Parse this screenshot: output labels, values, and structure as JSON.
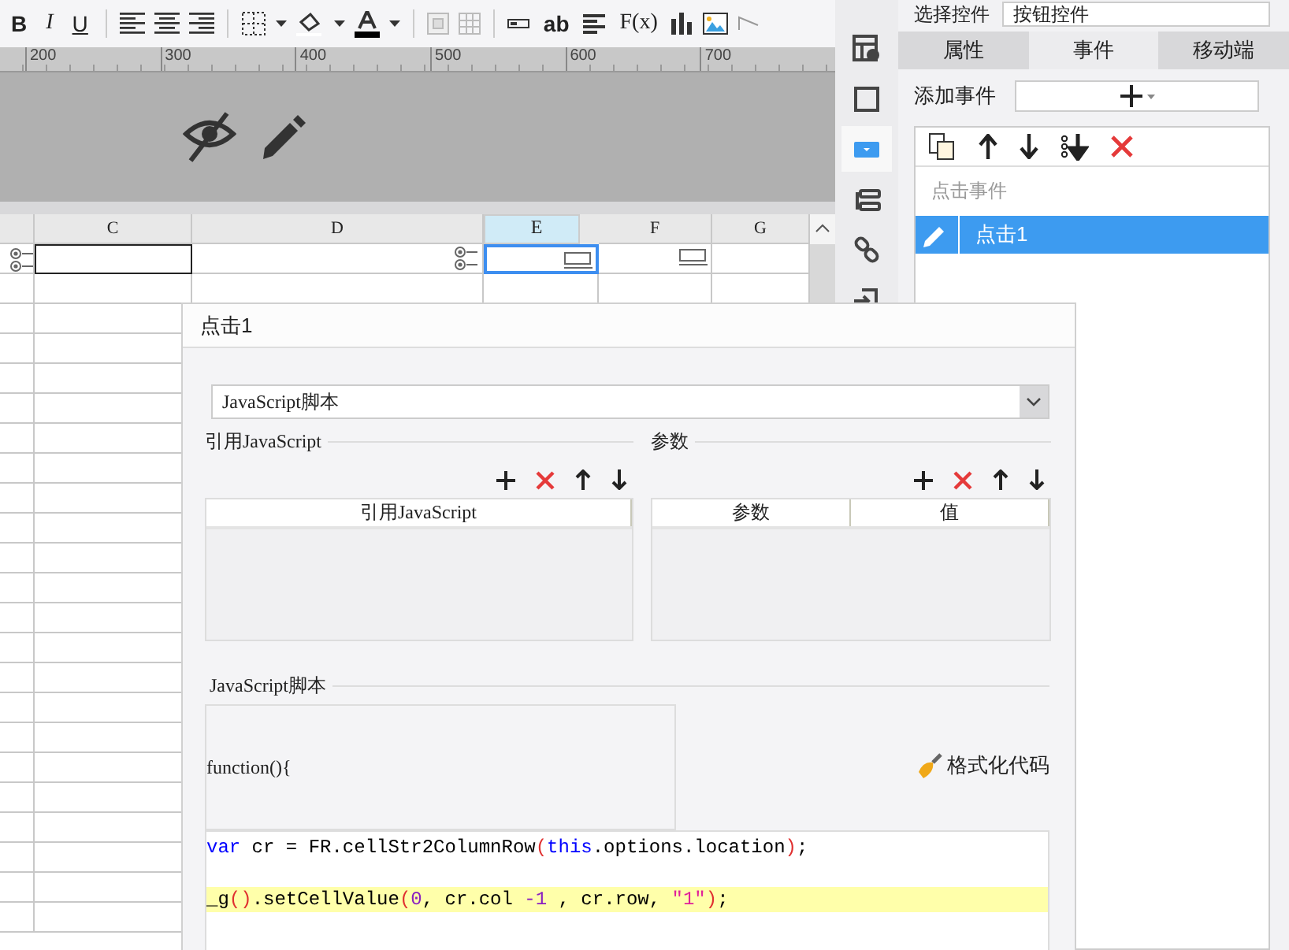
{
  "toolbar": {
    "bold": "B",
    "italic": "I",
    "underline": "U",
    "text_field": "ab",
    "formula": "F(x)"
  },
  "ruler": [
    "200",
    "300",
    "400",
    "500",
    "600",
    "700"
  ],
  "columns": [
    {
      "label": "C",
      "selected": false
    },
    {
      "label": "D",
      "selected": false
    },
    {
      "label": "E",
      "selected": true
    },
    {
      "label": "F",
      "selected": false
    },
    {
      "label": "G",
      "selected": false
    }
  ],
  "side_toolbar": [
    {
      "selected": false
    },
    {
      "selected": false
    },
    {
      "selected": true
    },
    {
      "selected": false
    },
    {
      "selected": false
    },
    {
      "selected": false
    }
  ],
  "right_panel": {
    "select_label": "选择控件",
    "select_value": "按钮控件",
    "tabs": [
      {
        "label": "属性",
        "selected": false
      },
      {
        "label": "事件",
        "selected": true
      },
      {
        "label": "移动端",
        "selected": false
      }
    ],
    "add_event_label": "添加事件",
    "event_header": "点击事件",
    "events": [
      {
        "label": "点击1",
        "selected": true
      }
    ]
  },
  "dialog": {
    "title": "点击1",
    "type_select": "JavaScript脚本",
    "imports": {
      "title": "引用JavaScript",
      "columns": [
        "引用JavaScript"
      ]
    },
    "params": {
      "title": "参数",
      "columns": [
        "参数",
        "值"
      ]
    },
    "script": {
      "title": "JavaScript脚本",
      "header": "function(){",
      "format_button": "格式化代码",
      "lines": [
        {
          "highlighted": false,
          "tokens": [
            {
              "kind": "keyword",
              "text": "var"
            },
            {
              "kind": "plain",
              "text": " cr = FR.cellStr2ColumnRow"
            },
            {
              "kind": "paren",
              "text": "("
            },
            {
              "kind": "keyword",
              "text": "this"
            },
            {
              "kind": "plain",
              "text": ".options.location"
            },
            {
              "kind": "paren",
              "text": ")"
            },
            {
              "kind": "plain",
              "text": ";"
            }
          ]
        },
        {
          "highlighted": true,
          "tokens": [
            {
              "kind": "plain",
              "text": "_g"
            },
            {
              "kind": "paren",
              "text": "()"
            },
            {
              "kind": "plain",
              "text": ".setCellValue"
            },
            {
              "kind": "paren",
              "text": "("
            },
            {
              "kind": "number",
              "text": "0"
            },
            {
              "kind": "plain",
              "text": ", cr.col "
            },
            {
              "kind": "number",
              "text": "-1"
            },
            {
              "kind": "plain",
              "text": " , cr.row, "
            },
            {
              "kind": "string",
              "text": "\"1\""
            },
            {
              "kind": "paren",
              "text": ")"
            },
            {
              "kind": "plain",
              "text": ";"
            }
          ]
        }
      ]
    }
  }
}
